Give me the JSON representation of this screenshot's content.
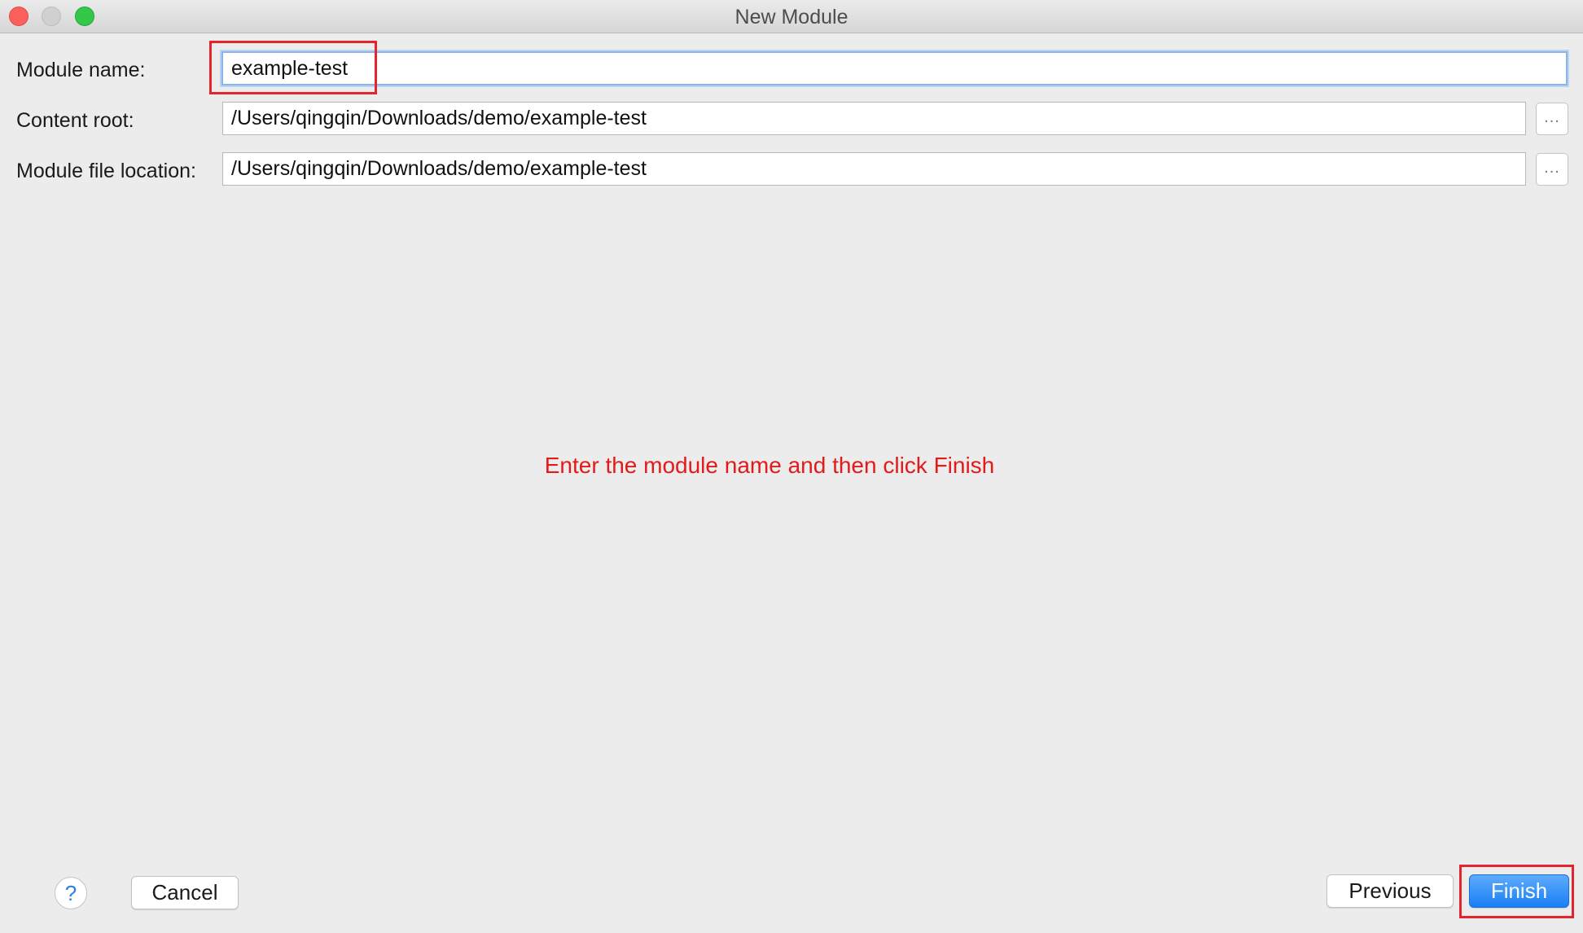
{
  "window": {
    "title": "New Module"
  },
  "form": {
    "module_name_label": "Module name:",
    "module_name_value": "example-test",
    "content_root_label": "Content root:",
    "content_root_value": "/Users/qingqin/Downloads/demo/example-test",
    "module_file_location_label": "Module file location:",
    "module_file_location_value": "/Users/qingqin/Downloads/demo/example-test",
    "browse_label": "..."
  },
  "annotation": {
    "instruction": "Enter the module name and then click Finish",
    "color": "#e31a1a",
    "highlight_color": "#e3262e"
  },
  "buttons": {
    "help": "?",
    "cancel": "Cancel",
    "previous": "Previous",
    "finish": "Finish"
  },
  "colors": {
    "accent": "#1a7ff5",
    "focus_ring": "#8db4e8"
  }
}
